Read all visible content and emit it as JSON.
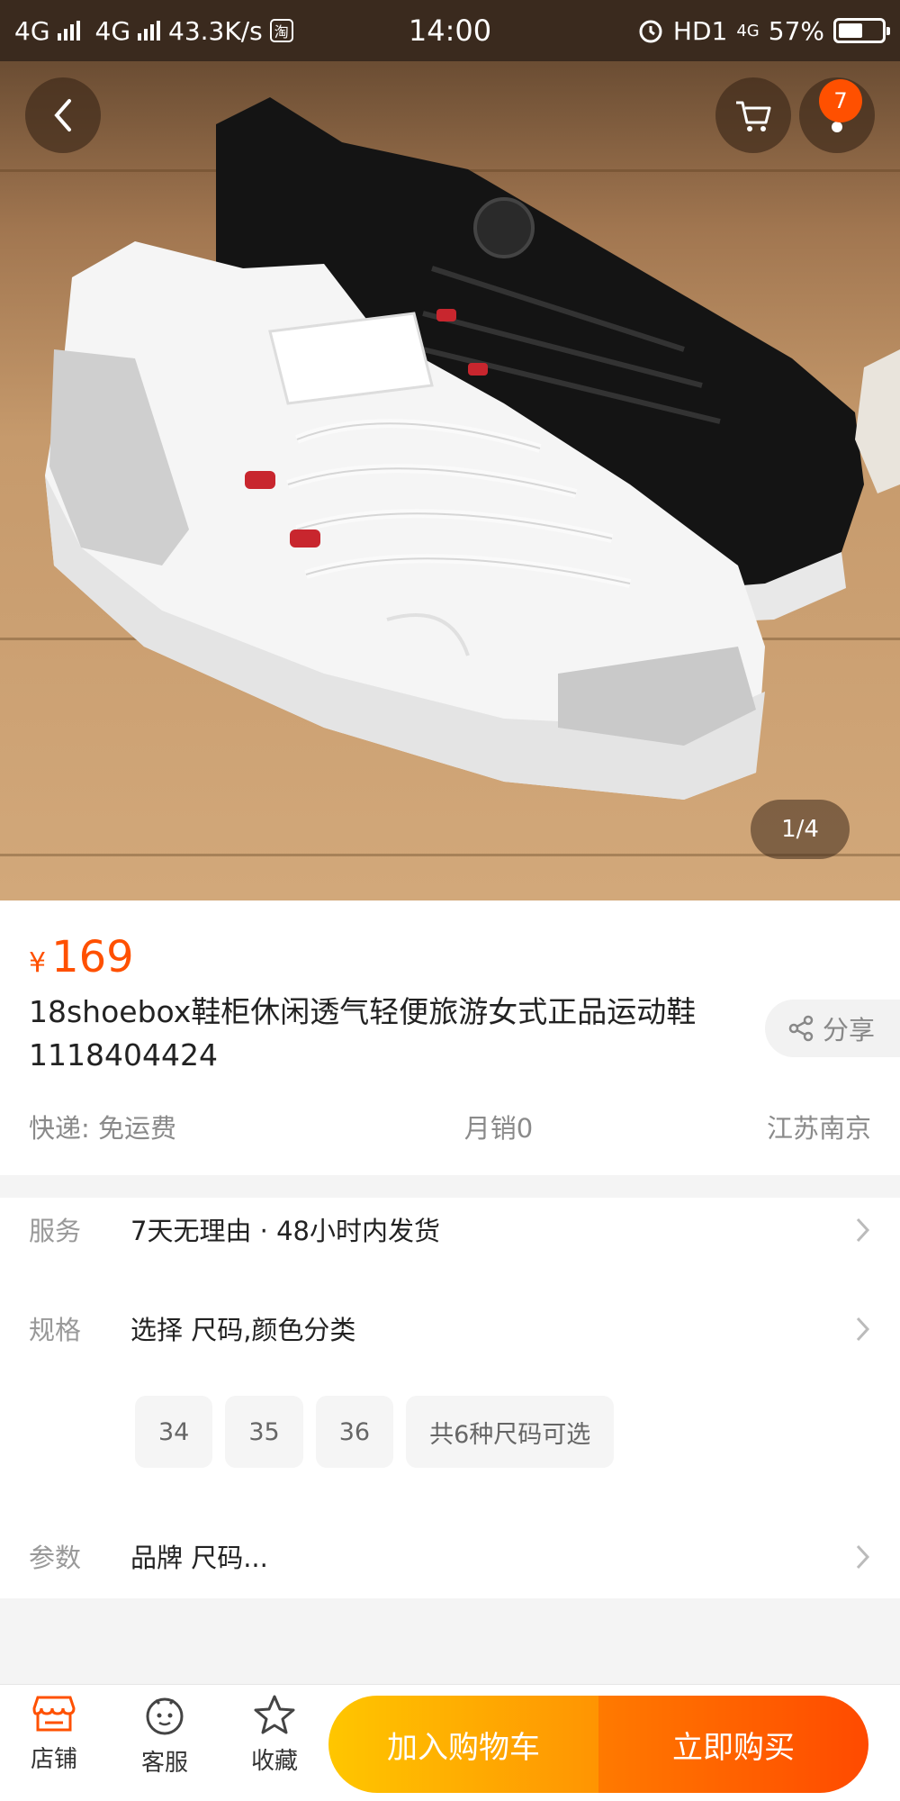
{
  "status_bar": {
    "net1": "4G",
    "net2": "4G",
    "speed": "43.3K/s",
    "app_chip": "淘",
    "time": "14:00",
    "hd": "HD1",
    "net3": "4G",
    "battery_percent": "57%",
    "battery_level": 0.57
  },
  "gallery": {
    "cart_badge_count": "7",
    "counter": "1/4"
  },
  "product": {
    "currency": "¥",
    "price": "169",
    "title": "18shoebox鞋柜休闲透气轻便旅游女式正品运动鞋1118404424",
    "share_label": "分享",
    "shipping": "快递: 免运费",
    "monthly_sales": "月销0",
    "location": "江苏南京"
  },
  "options": {
    "service_label": "服务",
    "service_value": "7天无理由 · 48小时内发货",
    "spec_label": "规格",
    "spec_value": "选择 尺码,颜色分类",
    "size_chips": [
      "34",
      "35",
      "36",
      "共6种尺码可选"
    ],
    "params_label": "参数",
    "params_value": "品牌 尺码..."
  },
  "bottom_bar": {
    "shop": "店铺",
    "service": "客服",
    "favorite": "收藏",
    "add_to_cart": "加入购物车",
    "buy_now": "立即购买"
  },
  "colors": {
    "accent": "#ff5000",
    "cart_button_start": "#ffc600",
    "buy_button_end": "#ff4a00"
  }
}
